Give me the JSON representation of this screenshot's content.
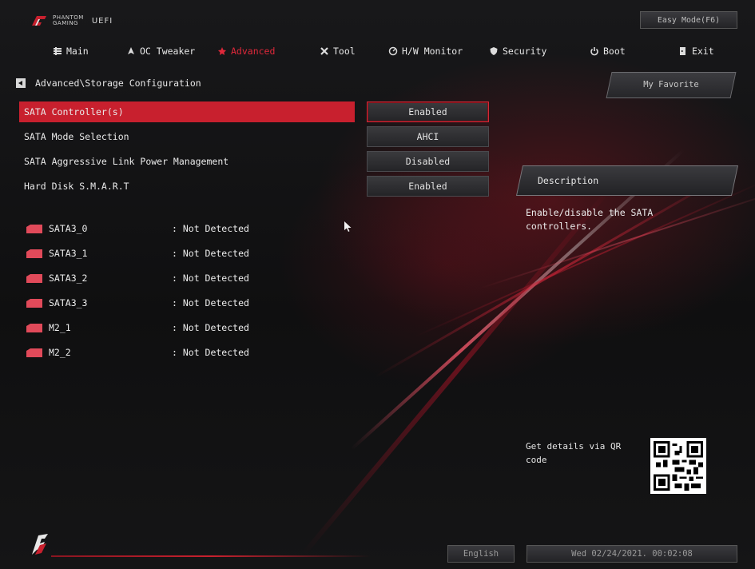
{
  "header": {
    "logo_text_1": "PHANTOM",
    "logo_text_2": "GAMING",
    "uefi_label": "UEFI",
    "easy_mode_label": "Easy Mode(F6)"
  },
  "nav": {
    "items": [
      {
        "label": "Main",
        "icon": "grid-icon"
      },
      {
        "label": "OC Tweaker",
        "icon": "rocket-icon"
      },
      {
        "label": "Advanced",
        "icon": "star-icon",
        "active": true
      },
      {
        "label": "Tool",
        "icon": "tools-icon"
      },
      {
        "label": "H/W Monitor",
        "icon": "monitor-icon"
      },
      {
        "label": "Security",
        "icon": "shield-icon"
      },
      {
        "label": "Boot",
        "icon": "power-icon"
      },
      {
        "label": "Exit",
        "icon": "exit-icon"
      }
    ]
  },
  "breadcrumb": "Advanced\\Storage Configuration",
  "favorite_label": "My Favorite",
  "settings": [
    {
      "label": "SATA Controller(s)",
      "value": "Enabled",
      "selected": true
    },
    {
      "label": "SATA Mode Selection",
      "value": "AHCI"
    },
    {
      "label": "SATA Aggressive Link Power Management",
      "value": "Disabled"
    },
    {
      "label": "Hard Disk S.M.A.R.T",
      "value": "Enabled"
    }
  ],
  "drives": [
    {
      "name": "SATA3_0",
      "status": ": Not Detected"
    },
    {
      "name": "SATA3_1",
      "status": ": Not Detected"
    },
    {
      "name": "SATA3_2",
      "status": ": Not Detected"
    },
    {
      "name": "SATA3_3",
      "status": ": Not Detected"
    },
    {
      "name": "M2_1",
      "status": ": Not Detected"
    },
    {
      "name": "M2_2",
      "status": ": Not Detected"
    }
  ],
  "description": {
    "header": "Description",
    "text": "Enable/disable the SATA controllers."
  },
  "qr_text": "Get details via QR code",
  "footer": {
    "language": "English",
    "datetime": "Wed 02/24/2021. 00:02:08"
  },
  "colors": {
    "accent": "#c8202e",
    "active_nav": "#e0283a",
    "background": "#111112"
  }
}
